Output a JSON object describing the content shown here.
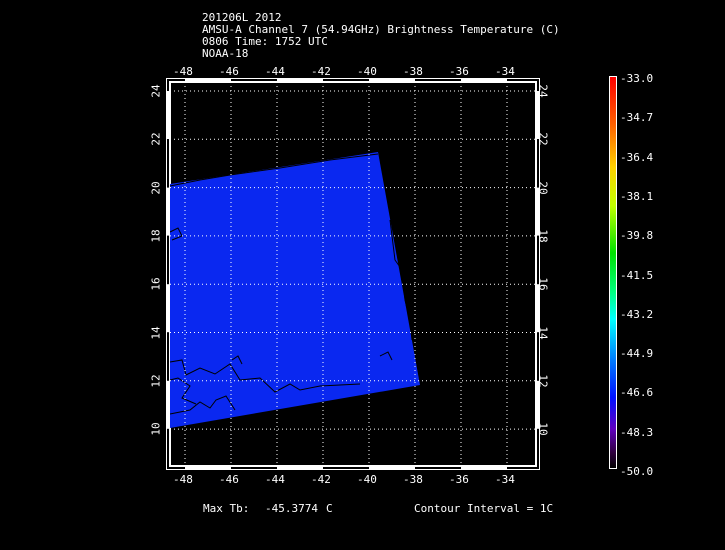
{
  "title": {
    "line1": "201206L 2012",
    "line2": "AMSU-A Channel 7 (54.94GHz) Brightness Temperature (C)",
    "line3": "0806 Time: 1752 UTC",
    "line4": "NOAA-18"
  },
  "map": {
    "lon_labels": [
      "-48",
      "-46",
      "-44",
      "-42",
      "-40",
      "-38",
      "-36",
      "-34"
    ],
    "lat_labels": [
      "24",
      "22",
      "20",
      "18",
      "16",
      "14",
      "12",
      "10"
    ],
    "swath_color": "#0a28f0"
  },
  "colorbar": {
    "labels": [
      "-33.0",
      "-34.7",
      "-36.4",
      "-38.1",
      "-39.8",
      "-41.5",
      "-43.2",
      "-44.9",
      "-46.6",
      "-48.3",
      "-50.0"
    ]
  },
  "footer": {
    "max_label": "Max Tb:",
    "max_value": "-45.3774",
    "max_unit": "C",
    "contour": "Contour Interval = 1C"
  }
}
